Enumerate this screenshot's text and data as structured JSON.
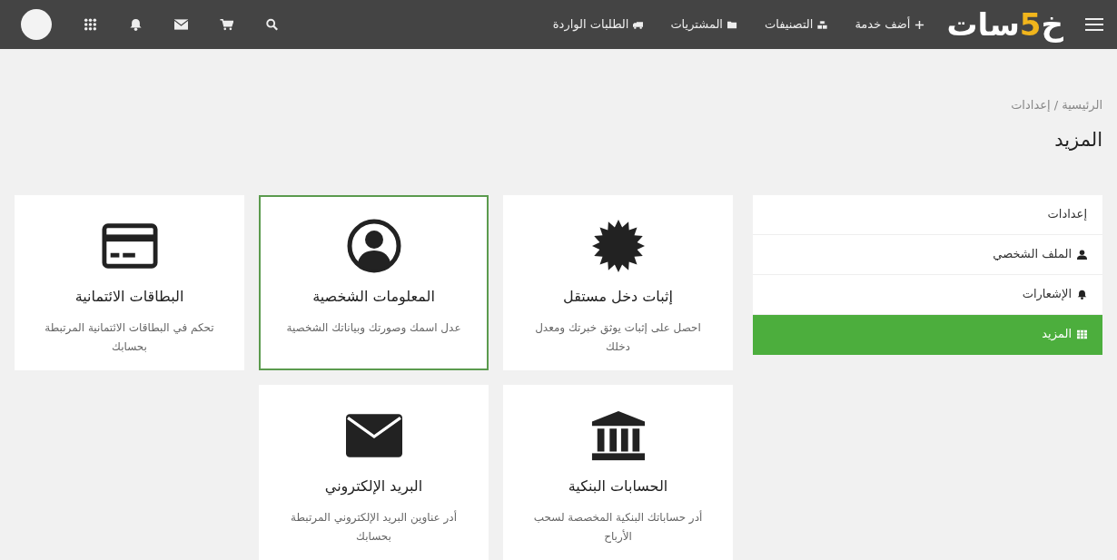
{
  "navbar": {
    "logo": "خ5سات",
    "links": [
      {
        "label": "أضف خدمة",
        "kind": "plus"
      },
      {
        "label": "التصنيفات",
        "kind": "cubes"
      },
      {
        "label": "المشتريات",
        "kind": "folder"
      },
      {
        "label": "الطلبات الواردة",
        "kind": "truck"
      }
    ]
  },
  "breadcrumb": "الرئيسية / إعدادات",
  "page_title": "المزيد",
  "sidebar": {
    "heading": "إعدادات",
    "items": [
      {
        "label": "الملف الشخصي",
        "kind": "user",
        "selected": false
      },
      {
        "label": "الإشعارات",
        "kind": "bell",
        "selected": false
      },
      {
        "label": "المزيد",
        "kind": "grid",
        "selected": true
      }
    ]
  },
  "cards": [
    {
      "title": "إثبات دخل مستقل",
      "description": "احصل على إثبات يوثق خبرتك ومعدل دخلك",
      "kind": "badge",
      "selected": false
    },
    {
      "title": "المعلومات الشخصية",
      "description": "عدل اسمك وصورتك وبياناتك الشخصية",
      "kind": "user",
      "selected": true
    },
    {
      "title": "البطاقات الائتمانية",
      "description": "تحكم في البطاقات الائتمانية المرتبطة بحسابك",
      "kind": "card",
      "selected": false
    },
    {
      "title": "الحسابات البنكية",
      "description": "أدر حساباتك البنكية المخصصة لسحب الأرباح",
      "kind": "bank",
      "selected": false
    },
    {
      "title": "البريد الإلكتروني",
      "description": "أدر عناوين البريد الإلكتروني المرتبطة بحسابك",
      "kind": "mail",
      "selected": false
    }
  ]
}
